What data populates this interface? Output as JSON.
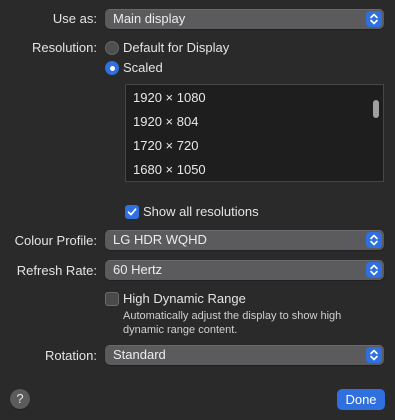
{
  "use_as": {
    "label": "Use as:",
    "value": "Main display"
  },
  "resolution": {
    "label": "Resolution:",
    "options": [
      {
        "label": "Default for Display",
        "selected": false
      },
      {
        "label": "Scaled",
        "selected": true
      }
    ],
    "list": [
      "1920 × 1080",
      "1920 × 804",
      "1720 × 720",
      "1680 × 1050"
    ],
    "show_all": {
      "label": "Show all resolutions",
      "checked": true
    }
  },
  "colour_profile": {
    "label": "Colour Profile:",
    "value": "LG HDR WQHD"
  },
  "refresh_rate": {
    "label": "Refresh Rate:",
    "value": "60 Hertz"
  },
  "hdr": {
    "label": "High Dynamic Range",
    "checked": false,
    "description": "Automatically adjust the display to show high dynamic range content."
  },
  "rotation": {
    "label": "Rotation:",
    "value": "Standard"
  },
  "footer": {
    "help": "?",
    "done": "Done"
  },
  "colors": {
    "accent": "#2f6fde",
    "background": "#2a2a2b",
    "popup": "#5b5b5d"
  }
}
